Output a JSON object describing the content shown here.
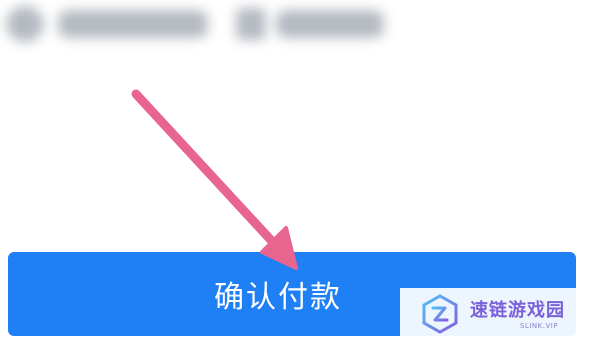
{
  "button": {
    "label": "确认付款",
    "color": "#1f80f5"
  },
  "annotation": {
    "icon": "arrow-icon",
    "color": "#e8658f"
  },
  "watermark": {
    "title": "速链游戏园",
    "subtitle": "SLINK.VIP",
    "logo_icon": "slink-logo-icon"
  }
}
